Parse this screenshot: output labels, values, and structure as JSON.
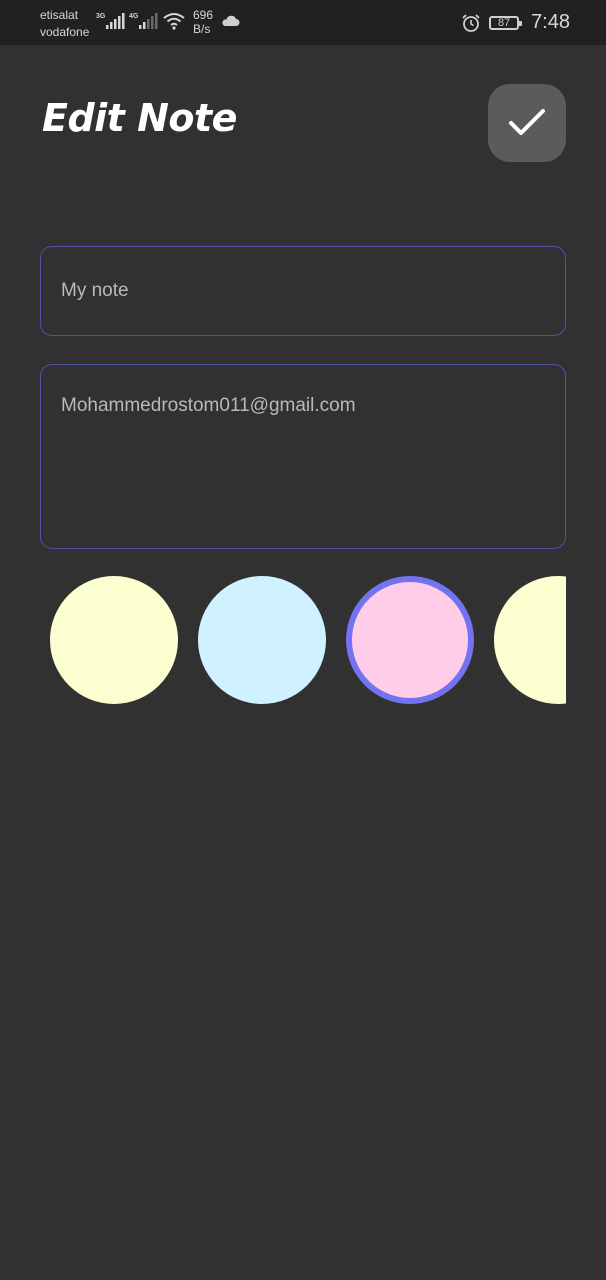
{
  "status_bar": {
    "carrier_1": "etisalat",
    "carrier_2": "vodafone",
    "network_1": "3G",
    "network_2": "4G",
    "speed_value": "696",
    "speed_unit": "B/s",
    "battery": "87",
    "time": "7:48"
  },
  "header": {
    "title": "Edit Note"
  },
  "form": {
    "title_value": "My note",
    "content_value": "Mohammedrostom011@gmail.com"
  },
  "color_picker": {
    "selected_index": 2,
    "selected_border": "#7373f0",
    "colors": [
      "#fbffd0",
      "#d0f1ff",
      "#ffcde8",
      "#fbffd0"
    ]
  },
  "theme": {
    "background": "#313131",
    "status_bar_bg": "#212121",
    "field_border": "#4e53a3",
    "save_button_bg": "#5b5b5b"
  }
}
